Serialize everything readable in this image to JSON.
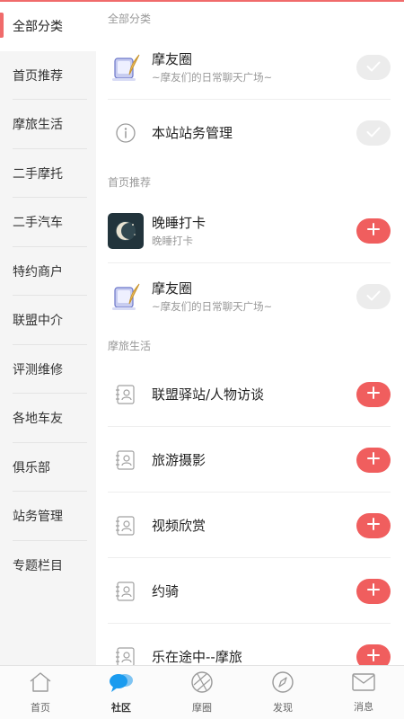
{
  "sidebar": {
    "items": [
      {
        "label": "全部分类",
        "active": true
      },
      {
        "label": "首页推荐"
      },
      {
        "label": "摩旅生活"
      },
      {
        "label": "二手摩托"
      },
      {
        "label": "二手汽车"
      },
      {
        "label": "特约商户"
      },
      {
        "label": "联盟中介"
      },
      {
        "label": "评测维修"
      },
      {
        "label": "各地车友"
      },
      {
        "label": "俱乐部"
      },
      {
        "label": "站务管理"
      },
      {
        "label": "专题栏目"
      }
    ]
  },
  "main": {
    "sections": [
      {
        "title": "全部分类",
        "rows": [
          {
            "title": "摩友圈",
            "subtitle": "~摩友们的日常聊天广场~",
            "icon": "feather-pad-icon",
            "state": "added"
          },
          {
            "title": "本站站务管理",
            "subtitle": "",
            "icon": "info-circle-icon",
            "state": "added"
          }
        ]
      },
      {
        "title": "首页推荐",
        "rows": [
          {
            "title": "晚睡打卡",
            "subtitle": "晚睡打卡",
            "icon": "moon-avatar-icon",
            "state": "add"
          },
          {
            "title": "摩友圈",
            "subtitle": "~摩友们的日常聊天广场~",
            "icon": "feather-pad-icon",
            "state": "added"
          }
        ]
      },
      {
        "title": "摩旅生活",
        "rows": [
          {
            "title": "联盟驿站/人物访谈",
            "subtitle": "",
            "icon": "contact-card-icon",
            "state": "add"
          },
          {
            "title": "旅游摄影",
            "subtitle": "",
            "icon": "contact-card-icon",
            "state": "add"
          },
          {
            "title": "视频欣赏",
            "subtitle": "",
            "icon": "contact-card-icon",
            "state": "add"
          },
          {
            "title": "约骑",
            "subtitle": "",
            "icon": "contact-card-icon",
            "state": "add"
          },
          {
            "title": "乐在途中--摩旅",
            "subtitle": "",
            "icon": "contact-card-icon",
            "state": "add"
          }
        ]
      }
    ]
  },
  "tabbar": {
    "tabs": [
      {
        "label": "首页",
        "icon": "home-icon"
      },
      {
        "label": "社区",
        "icon": "chat-bubbles-icon",
        "active": true
      },
      {
        "label": "摩圈",
        "icon": "aperture-icon"
      },
      {
        "label": "发现",
        "icon": "compass-icon"
      },
      {
        "label": "消息",
        "icon": "mail-icon"
      }
    ]
  },
  "colors": {
    "accent": "#f05e5e",
    "added_pill": "#ececec",
    "active_tab": "#1a9bef"
  }
}
